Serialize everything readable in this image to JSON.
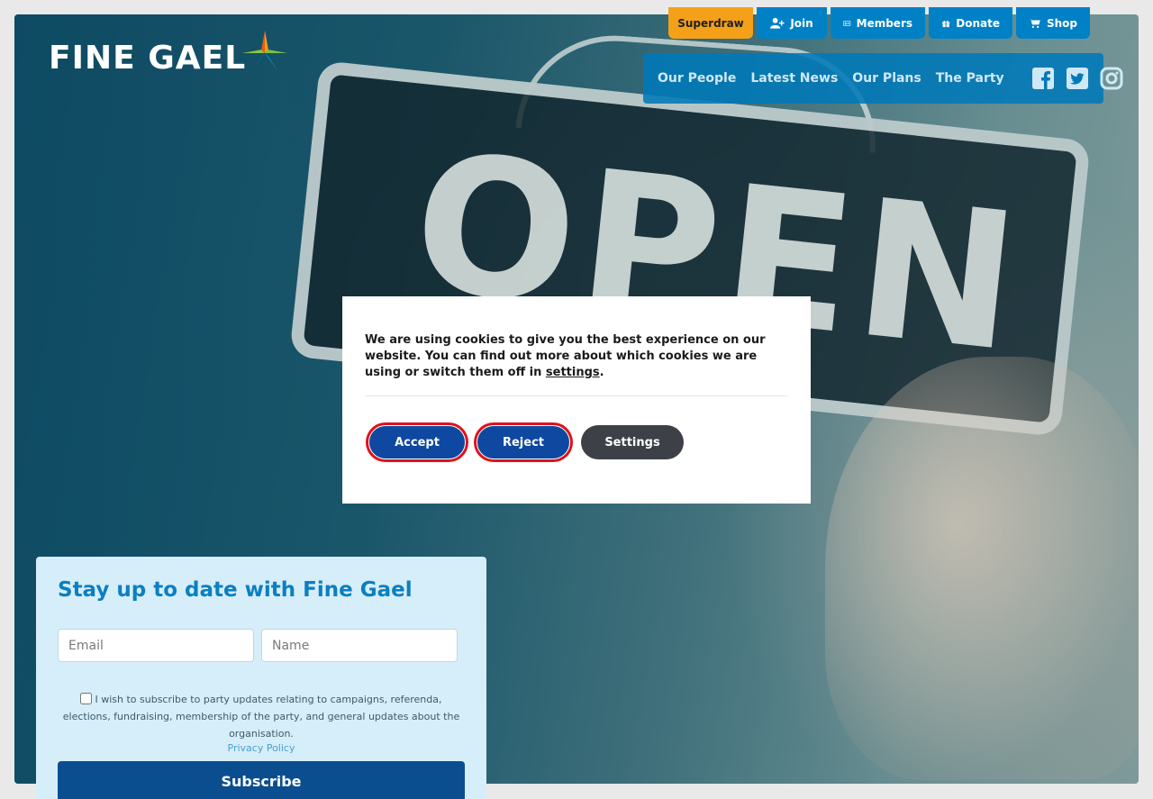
{
  "brand": {
    "logo_text": "FINE GAEL"
  },
  "utility_nav": [
    {
      "label": "Superdraw",
      "icon": "none"
    },
    {
      "label": "Join",
      "icon": "user-plus-icon"
    },
    {
      "label": "Members",
      "icon": "id-card-icon"
    },
    {
      "label": "Donate",
      "icon": "gift-icon"
    },
    {
      "label": "Shop",
      "icon": "cart-icon"
    }
  ],
  "main_nav": [
    "Our People",
    "Latest News",
    "Our Plans",
    "The Party"
  ],
  "social": [
    "facebook-icon",
    "twitter-icon",
    "instagram-icon"
  ],
  "hero": {
    "sign_text": "OPEN"
  },
  "subscribe": {
    "title": "Stay up to date with Fine Gael",
    "email_placeholder": "Email",
    "name_placeholder": "Name",
    "consent_text": "I wish to subscribe to party updates relating to campaigns, referenda, elections, fundraising, membership of the party, and general updates about the organisation.",
    "privacy_link": "Privacy Policy",
    "button": "Subscribe"
  },
  "cookie": {
    "text_before": "We are using cookies to give you the best experience on our website. You can find out more about which cookies we are using or switch them off in ",
    "link": "settings",
    "text_after": ".",
    "accept": "Accept",
    "reject": "Reject",
    "settings": "Settings"
  },
  "colors": {
    "primary_blue": "#0081c6",
    "superdraw_orange": "#f5a019",
    "subscribe_navy": "#0a4e8f",
    "cookie_button_blue": "#0e48a0",
    "highlight_red": "#e0121a"
  }
}
